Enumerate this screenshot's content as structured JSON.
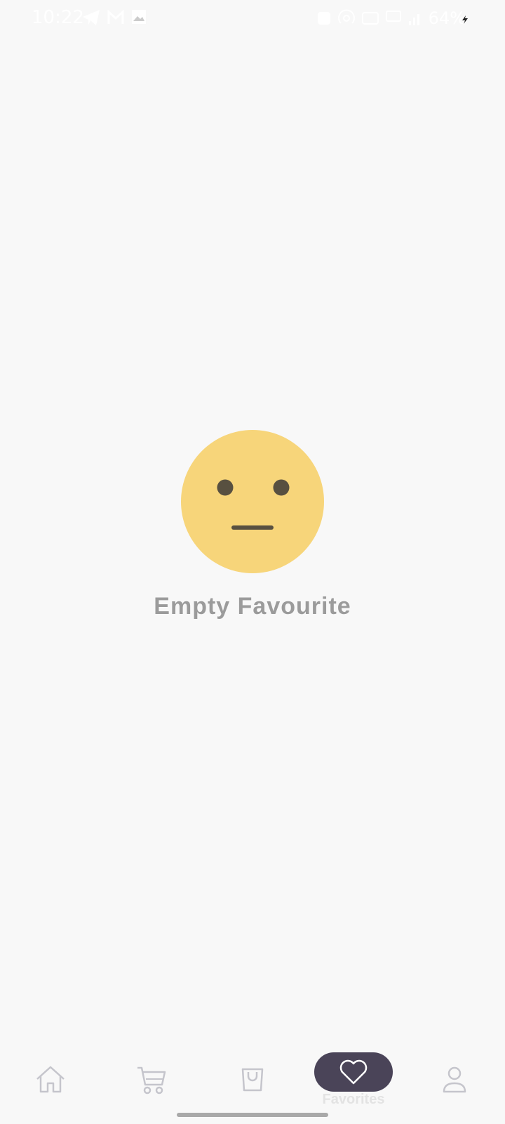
{
  "status_bar": {
    "time": "10:22",
    "battery": "64%"
  },
  "empty_state": {
    "message": "Empty Favourite",
    "emoji": "neutral-face"
  },
  "bottom_nav": {
    "items": [
      {
        "id": "home",
        "icon": "home-icon"
      },
      {
        "id": "cart",
        "icon": "cart-icon"
      },
      {
        "id": "shop",
        "icon": "shopping-bag-icon"
      },
      {
        "id": "favorites",
        "icon": "heart-icon",
        "label": "Favorites",
        "active": true
      },
      {
        "id": "profile",
        "icon": "person-icon"
      }
    ]
  },
  "colors": {
    "background": "#f8f8f8",
    "emoji_face": "#f7d57a",
    "emoji_features": "#585040",
    "text_muted": "#9b9b9b",
    "nav_active_bg": "#4a4458",
    "nav_icon": "#c5c5cc"
  }
}
